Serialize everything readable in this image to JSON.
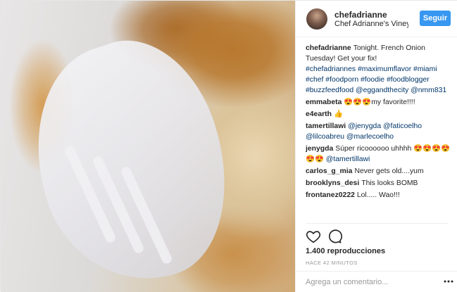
{
  "header": {
    "username": "chefadrianne",
    "location": "Chef Adrianne's Vineyar...",
    "follow_label": "Seguir"
  },
  "caption": {
    "user": "chefadrianne",
    "text": "Tonight. French Onion Tuesday! Get your fix!",
    "hashtags": "#chefadriannes #maximumflavor #miami #chef #foodporn #foodie #foodblogger #buzzfeedfood @eggandthecity @nmm831"
  },
  "comments": [
    {
      "user": "emmabeta",
      "text": "😍😍😍my favorite!!!!",
      "tags": ""
    },
    {
      "user": "e4earth",
      "text": "👍",
      "tags": ""
    },
    {
      "user": "tamertillawi",
      "text": "",
      "tags": "@jenygda @faticoelho @lilcoabreu @marlecoelho"
    },
    {
      "user": "jenygda",
      "text": "Súper ricoooooo uhhhh 😍😍😍😍😍😍",
      "tags": "@tamertillawi"
    },
    {
      "user": "carlos_g_mia",
      "text": "Never gets old....yum",
      "tags": ""
    },
    {
      "user": "brooklyns_desi",
      "text": "This looks BOMB",
      "tags": ""
    },
    {
      "user": "frontanez0222",
      "text": "Lol..... Wao!!!",
      "tags": ""
    }
  ],
  "stats": {
    "views": "1.400 reproducciones",
    "time": "HACE 42 MINUTOS"
  },
  "add_comment": {
    "placeholder": "Agrega un comentario..."
  },
  "colors": {
    "accent": "#3897f0",
    "link": "#003569"
  },
  "icons": {
    "like": "heart-icon",
    "comment": "comment-icon",
    "more": "more-icon"
  }
}
